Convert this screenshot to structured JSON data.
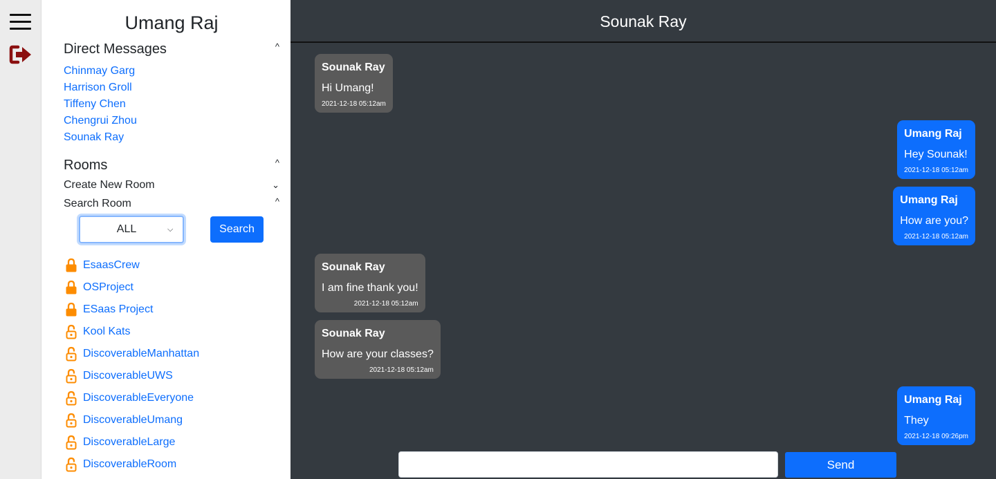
{
  "rail": {
    "menu_icon": "hamburger-icon",
    "logout_icon": "logout-icon",
    "logout_color": "#8b1010"
  },
  "sidebar": {
    "user_name": "Umang Raj",
    "direct_messages": {
      "title": "Direct Messages",
      "caret": "^",
      "contacts": [
        "Chinmay Garg",
        "Harrison Groll",
        "Tiffeny Chen",
        "Chengrui Zhou",
        "Sounak Ray"
      ]
    },
    "rooms": {
      "title": "Rooms",
      "caret": "^",
      "create_new_room": "Create New Room",
      "create_caret": "⌄",
      "search_room": "Search Room",
      "search_caret": "^",
      "filter_value": "ALL",
      "search_button": "Search",
      "lock_icon": "lock-icon",
      "lock_color": "#fd8c00",
      "items": [
        {
          "name": "EsaasCrew",
          "lock": "closed"
        },
        {
          "name": "OSProject",
          "lock": "closed"
        },
        {
          "name": "ESaas Project",
          "lock": "closed"
        },
        {
          "name": "Kool Kats",
          "lock": "open"
        },
        {
          "name": "DiscoverableManhattan",
          "lock": "open"
        },
        {
          "name": "DiscoverableUWS",
          "lock": "open"
        },
        {
          "name": "DiscoverableEveryone",
          "lock": "open"
        },
        {
          "name": "DiscoverableUmang",
          "lock": "open"
        },
        {
          "name": "DiscoverableLarge",
          "lock": "open"
        },
        {
          "name": "DiscoverableRoom",
          "lock": "open"
        }
      ]
    }
  },
  "chat": {
    "title": "Sounak Ray",
    "received_color": "#5a5a5a",
    "sent_color": "#0d6efd",
    "messages": [
      {
        "sender": "Sounak Ray",
        "text": "Hi Umang!",
        "time": "2021-12-18 05:12am",
        "direction": "received"
      },
      {
        "sender": "Umang Raj",
        "text": "Hey Sounak!",
        "time": "2021-12-18 05:12am",
        "direction": "sent"
      },
      {
        "sender": "Umang Raj",
        "text": "How are you?",
        "time": "2021-12-18 05:12am",
        "direction": "sent"
      },
      {
        "sender": "Sounak Ray",
        "text": "I am fine thank you!",
        "time": "2021-12-18 05:12am",
        "direction": "received"
      },
      {
        "sender": "Sounak Ray",
        "text": "How are your classes?",
        "time": "2021-12-18 05:12am",
        "direction": "received"
      },
      {
        "sender": "Umang Raj",
        "text": "They",
        "time": "2021-12-18 09:26pm",
        "direction": "sent"
      }
    ],
    "input_value": "",
    "send_button": "Send"
  }
}
